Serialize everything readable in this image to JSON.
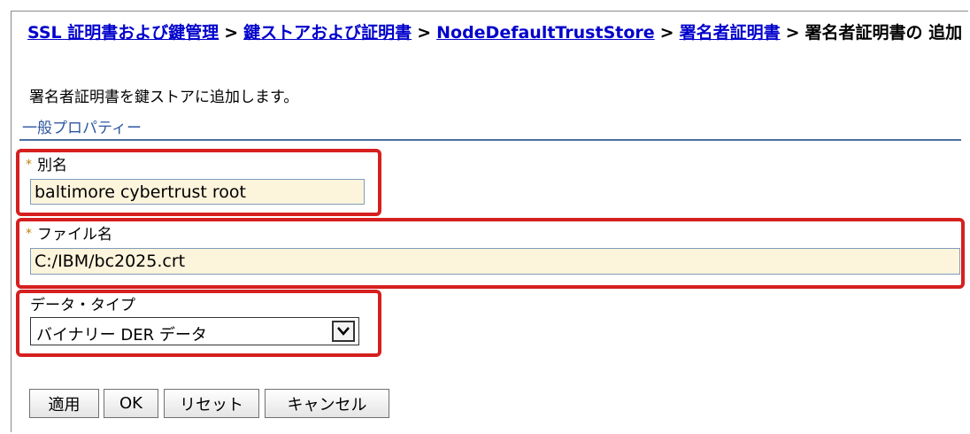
{
  "breadcrumb": {
    "link1": "SSL 証明書および鍵管理",
    "link2": "鍵ストアおよび証明書",
    "link3": "NodeDefaultTrustStore",
    "link4": "署名者証明書",
    "current": "署名者証明書の 追加",
    "separator": ">"
  },
  "description": "署名者証明書を鍵ストアに追加します。",
  "section": {
    "title": "一般プロパティー"
  },
  "fields": {
    "alias": {
      "label": "別名",
      "value": "baltimore cybertrust root",
      "required_mark": "*"
    },
    "filename": {
      "label": "ファイル名",
      "value": "C:/IBM/bc2025.crt",
      "required_mark": "*"
    },
    "datatype": {
      "label": "データ・タイプ",
      "selected": "バイナリー DER データ"
    }
  },
  "buttons": {
    "apply": "適用",
    "ok": "OK",
    "reset": "リセット",
    "cancel": "キャンセル"
  },
  "colors": {
    "link": "#0000cc",
    "highlight": "#d61f1f",
    "input_bg": "#fdf4dc",
    "section": "#2d57a0"
  }
}
